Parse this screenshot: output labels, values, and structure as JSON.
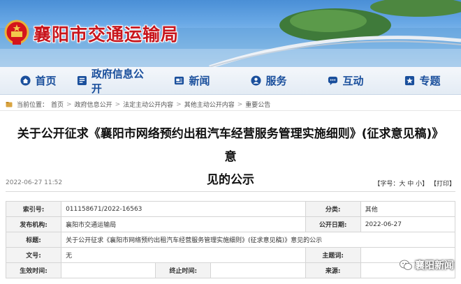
{
  "header": {
    "site_title": "襄阳市交通运输局"
  },
  "nav": [
    {
      "label": "首页",
      "icon": "home-icon"
    },
    {
      "label": "政府信息公开",
      "icon": "document-icon"
    },
    {
      "label": "新闻",
      "icon": "news-icon"
    },
    {
      "label": "服务",
      "icon": "service-icon"
    },
    {
      "label": "互动",
      "icon": "chat-icon"
    },
    {
      "label": "专题",
      "icon": "topic-icon"
    }
  ],
  "breadcrumb": {
    "prefix": "当前位置：",
    "items": [
      "首页",
      "政府信息公开",
      "法定主动公开内容",
      "其他主动公开内容",
      "重要公告"
    ]
  },
  "article": {
    "title_line1": "关于公开征求《襄阳市网络预约出租汽车经营服务管理实施细则》(征求意见稿)》意",
    "title_line2": "见的公示",
    "date": "2022-06-27 11:52",
    "tools": "【字号：大 中 小】 【打印】"
  },
  "info": {
    "index_label": "索引号:",
    "index_value": "011158671/2022-16563",
    "category_label": "分类:",
    "category_value": "其他",
    "publisher_label": "发布机构:",
    "publisher_value": "襄阳市交通运输局",
    "pubdate_label": "公开日期:",
    "pubdate_value": "2022-06-27",
    "title_label": "标题:",
    "title_value": "关于公开征求《襄阳市网络预约出租汽车经营服务管理实施细则》(征求意见稿)》意见的公示",
    "docno_label": "文号:",
    "docno_value": "无",
    "keyword_label": "主题词:",
    "keyword_value": "",
    "effective_label": "生效时间:",
    "effective_value": "",
    "expire_label": "终止时间:",
    "expire_value": "",
    "source_label": "来源:",
    "source_value": ""
  },
  "watermark": {
    "text": "襄阳新闻"
  },
  "colors": {
    "title_red": "#c8161d",
    "nav_blue": "#1a4f9c"
  }
}
